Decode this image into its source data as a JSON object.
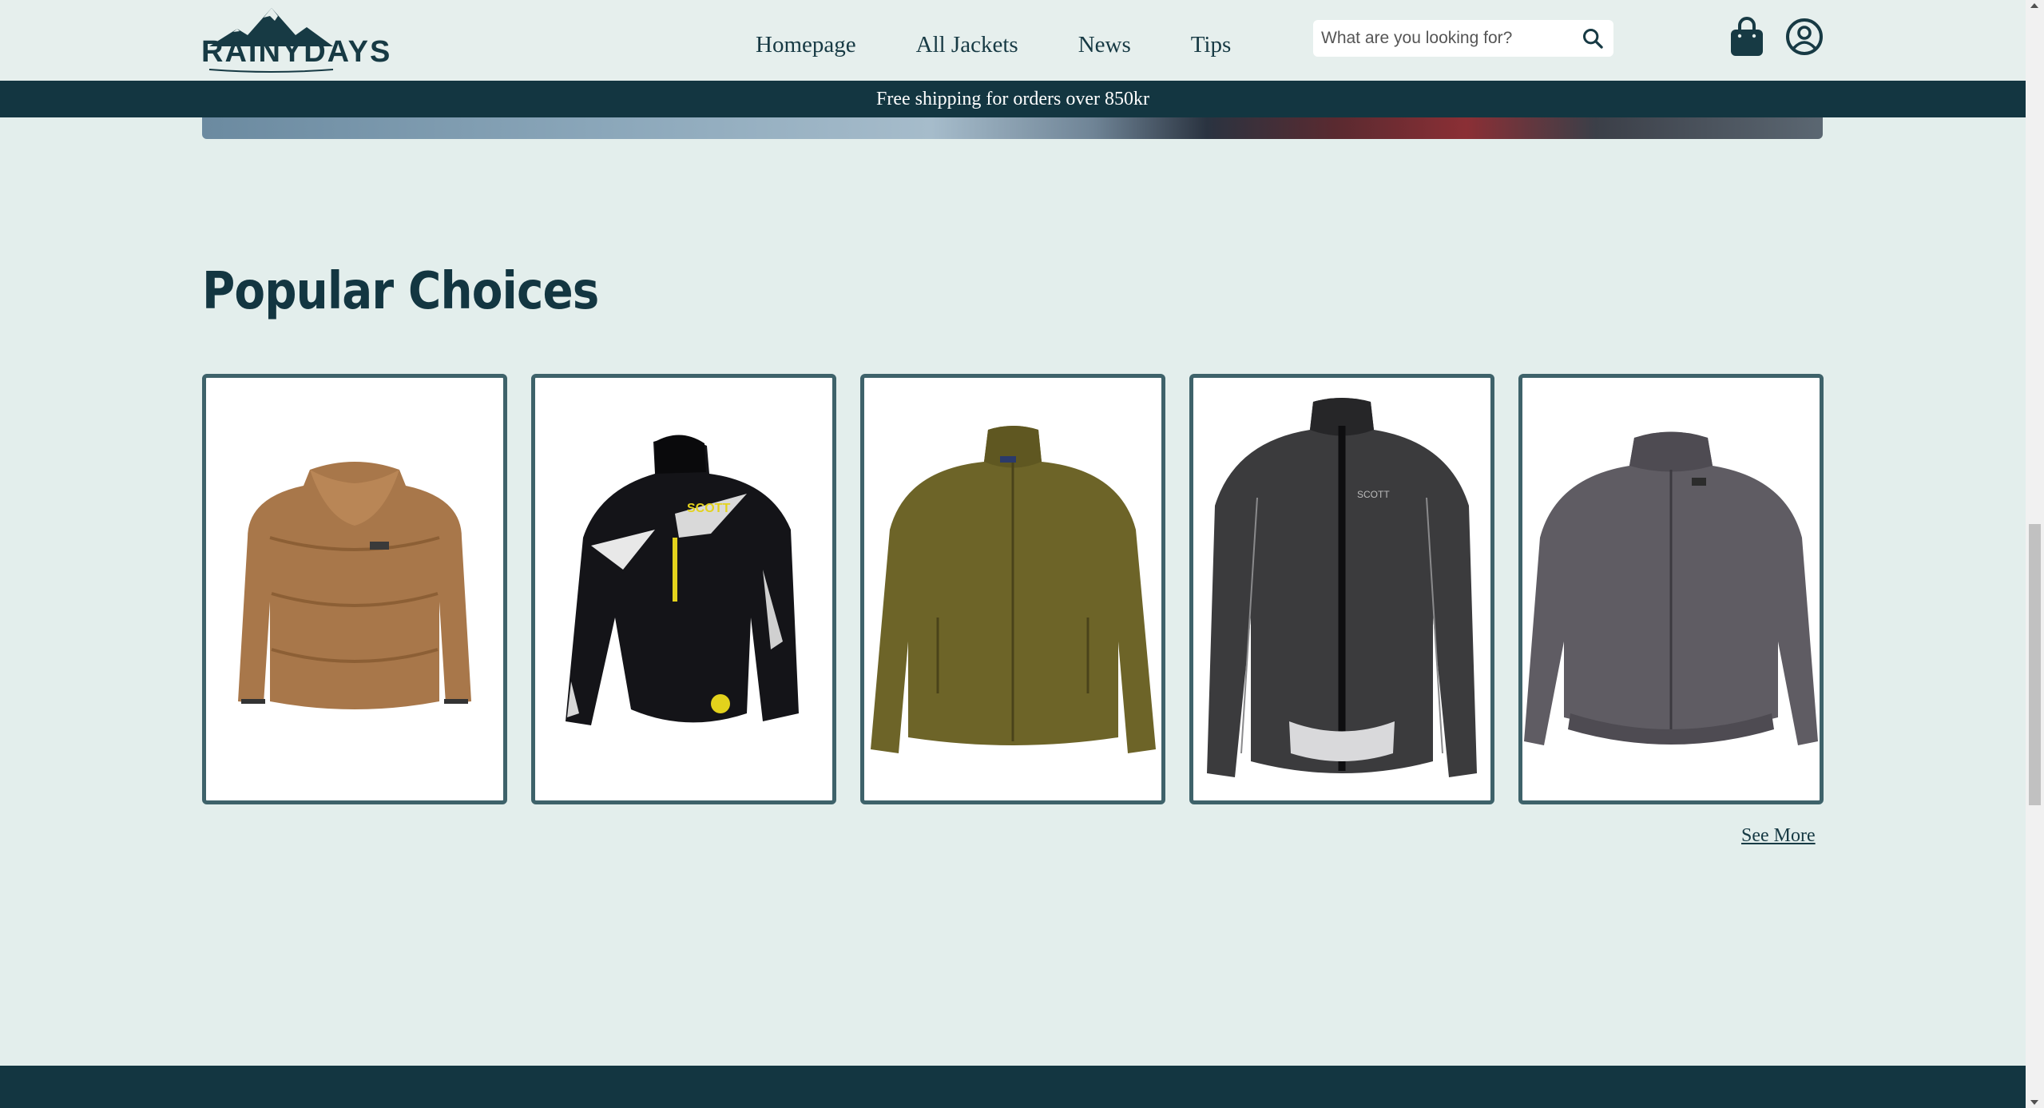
{
  "header": {
    "logo_text": "RAINYDAYS",
    "nav": [
      "Homepage",
      "All Jackets",
      "News",
      "Tips"
    ],
    "search_placeholder": "What are you looking for?",
    "icons": {
      "search": "search-icon",
      "bag": "shopping-bag-icon",
      "account": "user-account-icon"
    }
  },
  "banner": {
    "text": "Free shipping for orders over 850kr"
  },
  "popular": {
    "title": "Popular Choices",
    "products": [
      {
        "image": "brown-teddy-fleece-jacket"
      },
      {
        "image": "black-scott-racing-jacket"
      },
      {
        "image": "olive-fleece-zip-jacket"
      },
      {
        "image": "dark-grey-scott-cycling-jacket"
      },
      {
        "image": "grey-bomber-jacket"
      }
    ],
    "see_more": "See More"
  },
  "colors": {
    "primary": "#133641",
    "background": "#e3eeec",
    "card_border": "#3e626a"
  }
}
